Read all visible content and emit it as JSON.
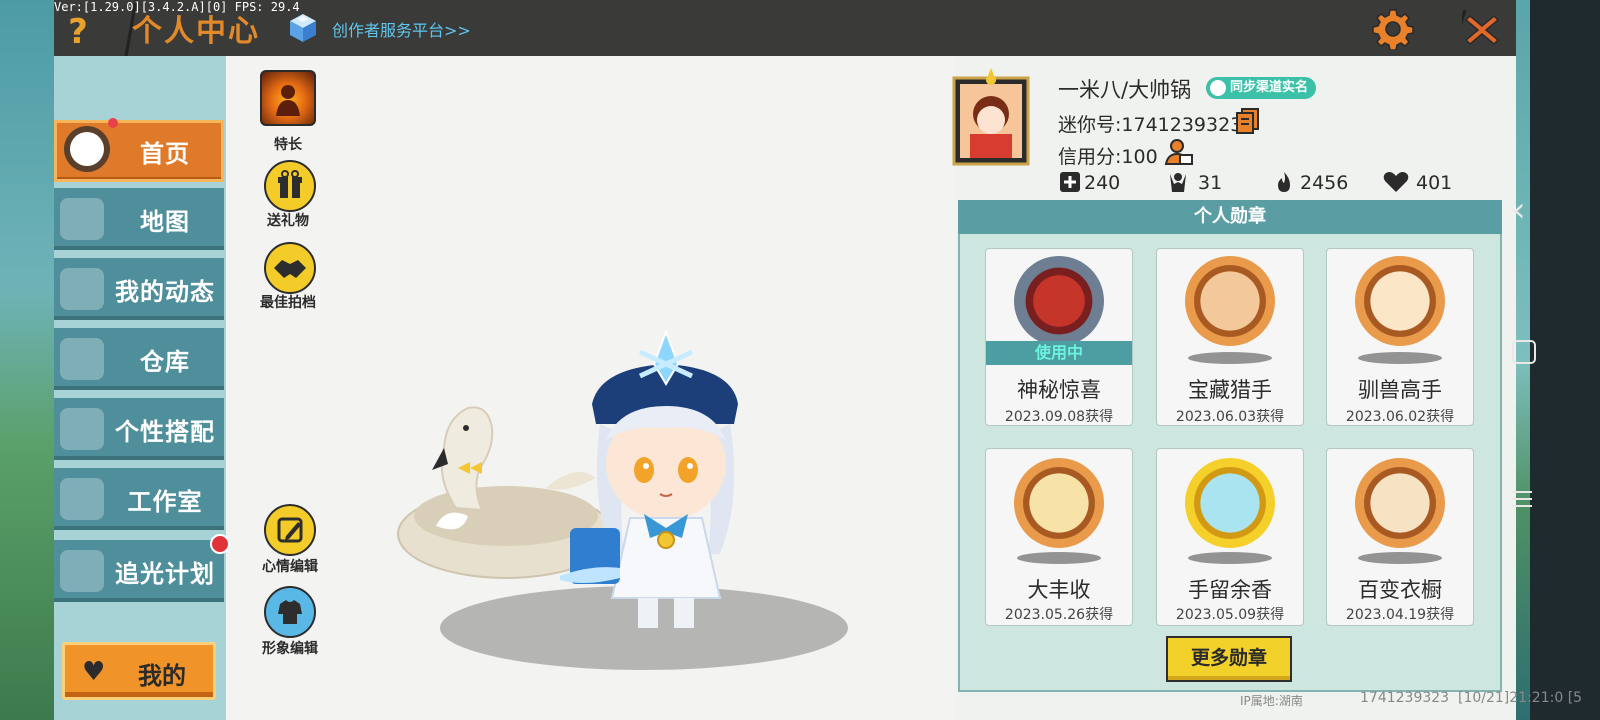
{
  "version_text": "Ver:[1.29.0][3.4.2.A][0] FPS: 29.4",
  "header": {
    "help_label": "?",
    "title": "个人中心",
    "creator_link": "创作者服务平台>>"
  },
  "sidebar": {
    "items": [
      {
        "label": "首页",
        "active": true
      },
      {
        "label": "地图"
      },
      {
        "label": "我的动态"
      },
      {
        "label": "仓库"
      },
      {
        "label": "个性搭配"
      },
      {
        "label": "工作室"
      },
      {
        "label": "追光计划"
      }
    ],
    "mine_label": "我的"
  },
  "actions": {
    "talent": "特长",
    "gift": "送礼物",
    "partner": "最佳拍档",
    "mood_edit": "心情编辑",
    "image_edit": "形象编辑"
  },
  "profile": {
    "name": "一米八/大帅锅",
    "sync_badge": "同步渠道实名",
    "mini_id": "迷你号:1741239323",
    "credit": "信用分:100",
    "stats": {
      "friends": "240",
      "fans": "31",
      "popularity": "2456",
      "likes": "401"
    }
  },
  "medals": {
    "title": "个人勋章",
    "in_use_label": "使用中",
    "items": [
      {
        "name": "神秘惊喜",
        "date": "2023.09.08获得",
        "in_use": true
      },
      {
        "name": "宝藏猎手",
        "date": "2023.06.03获得"
      },
      {
        "name": "驯兽高手",
        "date": "2023.06.02获得"
      },
      {
        "name": "大丰收",
        "date": "2023.05.26获得"
      },
      {
        "name": "手留余香",
        "date": "2023.05.09获得"
      },
      {
        "name": "百变衣橱",
        "date": "2023.04.19获得"
      }
    ],
    "more_label": "更多勋章"
  },
  "footer": {
    "ip": "IP属地:湖南",
    "id": "1741239323",
    "time": "[10/21]21:21:0 [5"
  },
  "colors": {
    "accent_orange": "#de7a2a",
    "nav_teal": "#4e8f9b",
    "badge_green": "#3ac1a7",
    "button_yellow": "#f3d12b"
  }
}
